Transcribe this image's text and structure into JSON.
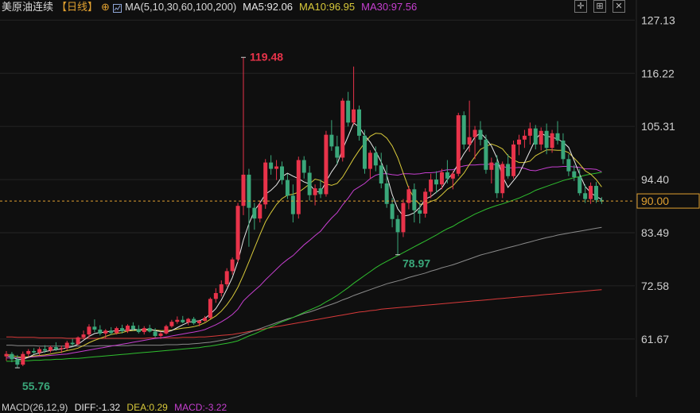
{
  "header": {
    "title": "美原油连续",
    "period": "【日线】",
    "add_icon": "plus-circle-icon",
    "indicator_icon": "chart-icon",
    "ma_def": "MA(5,10,30,60,100,200)",
    "ma5": "MA5:92.06",
    "ma10": "MA10:96.95",
    "ma30": "MA30:97.56"
  },
  "toolbar": {
    "icons": [
      "crosshair-icon",
      "layout-icon",
      "close-icon"
    ]
  },
  "macd": {
    "label": "MACD(26,12,9)",
    "diff": "DIFF:-1.32",
    "dea": "DEA:0.29",
    "macd": "MACD:-3.22"
  },
  "colors": {
    "up": "#e8334a",
    "down": "#3aa77a",
    "ma5": "#e8e8e8",
    "ma10": "#d8c93a",
    "ma30": "#c63fd0",
    "ma60": "#2fbf2f",
    "ma100": "#8a8a8a",
    "ma200": "#d83a3a",
    "current": "#e0a030"
  },
  "chart_data": {
    "type": "candlestick",
    "y_axis_ticks": [
      "127.13",
      "116.22",
      "105.31",
      "94.40",
      "83.49",
      "72.58",
      "61.67"
    ],
    "ylim": [
      53.0,
      128.0
    ],
    "current_price": "90.00",
    "annotations": {
      "high": "119.48",
      "low_mid": "78.97",
      "low_start": "55.76"
    },
    "ohlc": [
      [
        58.1,
        59.2,
        57.2,
        58.6
      ],
      [
        58.6,
        59.0,
        56.9,
        57.5
      ],
      [
        57.5,
        58.4,
        55.76,
        56.4
      ],
      [
        56.4,
        59.1,
        56.1,
        58.6
      ],
      [
        58.6,
        59.6,
        58.1,
        59.2
      ],
      [
        59.2,
        59.8,
        58.6,
        58.9
      ],
      [
        58.9,
        60.0,
        58.3,
        59.6
      ],
      [
        59.6,
        60.4,
        58.8,
        59.3
      ],
      [
        59.3,
        60.3,
        58.9,
        60.0
      ],
      [
        60.0,
        61.0,
        59.2,
        59.6
      ],
      [
        59.6,
        60.3,
        58.8,
        59.8
      ],
      [
        59.8,
        61.3,
        59.4,
        60.9
      ],
      [
        60.9,
        61.7,
        60.1,
        60.6
      ],
      [
        60.6,
        62.2,
        60.4,
        62.0
      ],
      [
        62.0,
        63.4,
        61.6,
        62.6
      ],
      [
        62.6,
        64.7,
        62.0,
        64.2
      ],
      [
        64.2,
        65.7,
        63.1,
        63.6
      ],
      [
        63.6,
        64.5,
        62.4,
        62.8
      ],
      [
        62.8,
        63.7,
        61.8,
        63.4
      ],
      [
        63.4,
        64.1,
        62.5,
        62.9
      ],
      [
        62.9,
        64.2,
        62.6,
        63.9
      ],
      [
        63.9,
        64.6,
        62.8,
        63.3
      ],
      [
        63.3,
        64.7,
        62.9,
        64.4
      ],
      [
        64.4,
        65.1,
        63.4,
        63.7
      ],
      [
        63.7,
        64.5,
        62.8,
        63.1
      ],
      [
        63.1,
        64.3,
        62.6,
        63.9
      ],
      [
        63.9,
        64.6,
        63.0,
        63.2
      ],
      [
        63.2,
        63.9,
        62.0,
        62.3
      ],
      [
        62.3,
        63.2,
        61.7,
        62.8
      ],
      [
        62.8,
        64.6,
        62.6,
        64.3
      ],
      [
        64.3,
        65.6,
        64.0,
        65.2
      ],
      [
        65.2,
        66.3,
        64.8,
        65.6
      ],
      [
        65.6,
        66.4,
        64.9,
        65.1
      ],
      [
        65.1,
        66.0,
        64.5,
        65.8
      ],
      [
        65.8,
        66.2,
        64.6,
        64.9
      ],
      [
        64.9,
        65.6,
        64.3,
        65.4
      ],
      [
        65.4,
        66.4,
        65.2,
        66.0
      ],
      [
        66.0,
        70.2,
        65.8,
        69.9
      ],
      [
        69.9,
        72.1,
        69.1,
        71.1
      ],
      [
        71.1,
        73.7,
        70.4,
        72.9
      ],
      [
        72.9,
        76.2,
        72.4,
        75.6
      ],
      [
        75.6,
        78.4,
        74.9,
        78.0
      ],
      [
        78.0,
        89.6,
        77.4,
        89.0
      ],
      [
        89.0,
        119.48,
        87.1,
        95.4
      ],
      [
        95.4,
        96.6,
        80.6,
        88.6
      ],
      [
        88.6,
        89.6,
        84.1,
        86.4
      ],
      [
        86.4,
        90.1,
        85.6,
        89.3
      ],
      [
        89.3,
        98.6,
        88.4,
        97.9
      ],
      [
        97.9,
        99.4,
        95.4,
        96.6
      ],
      [
        96.6,
        98.4,
        94.3,
        97.1
      ],
      [
        97.1,
        98.1,
        93.4,
        94.3
      ],
      [
        94.3,
        95.6,
        90.4,
        91.1
      ],
      [
        91.1,
        93.4,
        85.6,
        87.3
      ],
      [
        87.3,
        99.1,
        86.4,
        98.4
      ],
      [
        98.4,
        99.2,
        94.6,
        95.8
      ],
      [
        95.8,
        97.2,
        90.1,
        91.2
      ],
      [
        91.2,
        93.4,
        89.1,
        92.6
      ],
      [
        92.6,
        94.4,
        90.6,
        91.4
      ],
      [
        91.4,
        104.4,
        90.9,
        103.6
      ],
      [
        103.6,
        106.6,
        100.3,
        101.2
      ],
      [
        101.2,
        103.4,
        97.6,
        98.9
      ],
      [
        98.9,
        111.1,
        98.1,
        110.6
      ],
      [
        110.6,
        112.4,
        105.3,
        106.1
      ],
      [
        106.1,
        117.6,
        105.6,
        108.8
      ],
      [
        108.8,
        109.6,
        102.4,
        103.4
      ],
      [
        103.4,
        104.6,
        95.6,
        96.6
      ],
      [
        96.6,
        100.4,
        94.6,
        99.9
      ],
      [
        99.9,
        101.2,
        96.1,
        97.3
      ],
      [
        97.3,
        99.9,
        92.6,
        93.6
      ],
      [
        93.6,
        97.4,
        88.6,
        89.4
      ],
      [
        89.4,
        90.6,
        84.6,
        86.3
      ],
      [
        86.3,
        87.1,
        78.97,
        83.6
      ],
      [
        83.6,
        90.4,
        82.6,
        89.6
      ],
      [
        89.6,
        93.1,
        88.3,
        92.4
      ],
      [
        92.4,
        93.6,
        85.6,
        88.1
      ],
      [
        88.1,
        89.6,
        85.4,
        87.4
      ],
      [
        87.4,
        92.6,
        86.6,
        91.9
      ],
      [
        91.9,
        95.6,
        90.6,
        94.4
      ],
      [
        94.4,
        96.1,
        91.6,
        93.4
      ],
      [
        93.4,
        96.6,
        92.4,
        95.9
      ],
      [
        95.9,
        98.4,
        93.6,
        94.6
      ],
      [
        94.6,
        96.1,
        92.4,
        95.6
      ],
      [
        95.6,
        108.1,
        95.1,
        107.6
      ],
      [
        107.6,
        108.4,
        100.6,
        101.6
      ],
      [
        101.6,
        110.6,
        100.1,
        103.1
      ],
      [
        103.1,
        105.4,
        98.6,
        104.6
      ],
      [
        104.6,
        106.4,
        101.4,
        102.6
      ],
      [
        102.6,
        103.6,
        95.6,
        96.4
      ],
      [
        96.4,
        98.9,
        93.6,
        97.9
      ],
      [
        97.9,
        99.4,
        90.6,
        91.6
      ],
      [
        91.6,
        98.1,
        90.6,
        97.6
      ],
      [
        97.6,
        99.6,
        94.6,
        95.1
      ],
      [
        95.1,
        102.4,
        94.6,
        101.6
      ],
      [
        101.6,
        103.6,
        99.4,
        102.6
      ],
      [
        102.6,
        104.6,
        100.9,
        103.4
      ],
      [
        103.4,
        106.1,
        101.6,
        104.9
      ],
      [
        104.9,
        105.6,
        100.6,
        101.6
      ],
      [
        101.6,
        105.1,
        100.4,
        104.4
      ],
      [
        104.4,
        105.9,
        99.6,
        100.9
      ],
      [
        100.9,
        104.6,
        99.9,
        103.9
      ],
      [
        103.9,
        106.4,
        101.6,
        102.4
      ],
      [
        102.4,
        103.9,
        97.6,
        98.6
      ],
      [
        98.6,
        99.6,
        95.1,
        96.1
      ],
      [
        96.1,
        97.4,
        94.1,
        94.9
      ],
      [
        94.9,
        96.6,
        91.1,
        91.6
      ],
      [
        91.6,
        93.4,
        89.6,
        90.4
      ],
      [
        90.4,
        93.8,
        89.4,
        93.1
      ],
      [
        93.1,
        93.9,
        89.6,
        90.2
      ],
      [
        90.2,
        90.8,
        89.4,
        89.9
      ]
    ],
    "ma_series": [
      {
        "name": "MA5",
        "values": [
          58.2,
          58.0,
          57.5,
          57.5,
          57.9,
          58.5,
          58.8,
          59.1,
          59.3,
          59.5,
          59.6,
          59.9,
          60.1,
          60.6,
          61.4,
          62.2,
          62.8,
          63.0,
          63.1,
          63.3,
          63.3,
          63.4,
          63.5,
          63.6,
          63.6,
          63.6,
          63.7,
          63.4,
          63.2,
          63.1,
          63.4,
          64.0,
          64.6,
          65.1,
          65.3,
          65.4,
          65.9,
          66.8,
          67.9,
          69.7,
          71.9,
          74.3,
          77.6,
          82.0,
          85.3,
          88.0,
          89.6,
          91.4,
          92.2,
          93.3,
          95.0,
          95.7,
          95.1,
          94.6,
          93.9,
          93.5,
          92.0,
          91.8,
          94.0,
          96.0,
          97.6,
          100.6,
          103.3,
          106.0,
          105.2,
          103.5,
          102.1,
          100.2,
          98.0,
          95.3,
          91.3,
          88.4,
          86.9,
          87.1,
          87.6,
          88.7,
          90.4,
          90.9,
          91.8,
          92.7,
          94.4,
          95.7,
          97.7,
          99.7,
          101.3,
          103.1,
          104.0,
          102.8,
          101.3,
          98.8,
          95.1,
          92.8,
          94.2,
          95.6,
          97.9,
          100.3,
          102.7,
          103.9,
          103.3,
          103.1,
          102.7,
          102.1,
          101.0,
          98.3,
          95.5,
          93.0,
          91.7,
          90.9,
          90.3
        ]
      },
      {
        "name": "MA10",
        "values": [
          58.5,
          58.3,
          58.0,
          57.9,
          58.0,
          58.2,
          58.3,
          58.4,
          58.6,
          58.8,
          59.0,
          59.3,
          59.5,
          59.8,
          60.3,
          60.9,
          61.4,
          61.8,
          62.2,
          62.6,
          62.8,
          63.0,
          63.3,
          63.4,
          63.5,
          63.5,
          63.5,
          63.5,
          63.4,
          63.4,
          63.5,
          63.7,
          63.9,
          64.0,
          64.2,
          64.5,
          65.0,
          65.7,
          66.4,
          67.4,
          68.7,
          70.3,
          72.3,
          74.8,
          77.5,
          80.3,
          83.1,
          85.7,
          87.6,
          89.3,
          90.5,
          91.2,
          91.4,
          91.8,
          92.6,
          93.5,
          94.5,
          94.2,
          93.5,
          93.2,
          93.6,
          94.9,
          96.8,
          98.7,
          100.4,
          101.9,
          103.3,
          103.9,
          103.8,
          102.9,
          101.3,
          98.9,
          95.7,
          92.6,
          90.5,
          89.3,
          89.4,
          89.9,
          90.3,
          91.3,
          92.4,
          93.1,
          94.4,
          95.7,
          97.5,
          99.1,
          100.6,
          101.2,
          101.7,
          101.3,
          100.7,
          99.3,
          98.4,
          97.9,
          97.9,
          98.2,
          99.3,
          99.9,
          100.5,
          100.5,
          100.4,
          100.4,
          99.9,
          98.8,
          97.6,
          96.2,
          95.5,
          94.4,
          92.9
        ]
      },
      {
        "name": "MA30",
        "values": [
          57.8,
          57.8,
          57.8,
          57.8,
          57.9,
          58.0,
          58.1,
          58.2,
          58.3,
          58.4,
          58.5,
          58.6,
          58.8,
          59.0,
          59.2,
          59.4,
          59.6,
          59.8,
          60.0,
          60.2,
          60.4,
          60.6,
          60.8,
          61.0,
          61.2,
          61.4,
          61.6,
          61.8,
          61.9,
          62.1,
          62.3,
          62.5,
          62.7,
          62.9,
          63.1,
          63.3,
          63.6,
          64.1,
          64.6,
          65.2,
          65.9,
          66.7,
          67.8,
          69.5,
          70.6,
          71.6,
          72.6,
          73.8,
          74.9,
          76.0,
          77.1,
          78.0,
          78.8,
          79.9,
          81.0,
          81.9,
          82.9,
          83.8,
          85.2,
          86.5,
          87.6,
          89.2,
          90.6,
          92.2,
          92.9,
          93.6,
          94.6,
          95.3,
          95.6,
          95.6,
          95.4,
          95.3,
          95.6,
          95.6,
          95.5,
          95.6,
          95.8,
          95.8,
          95.9,
          96.2,
          96.4,
          96.4,
          96.9,
          97.2,
          97.4,
          97.4,
          97.5,
          97.5,
          97.6,
          97.4,
          97.1,
          96.8,
          96.8,
          96.9,
          96.7,
          96.3,
          96.2,
          96.5,
          96.8,
          97.0,
          97.0,
          97.1,
          97.1,
          97.0,
          96.9,
          96.6,
          96.6,
          96.5,
          96.0
        ]
      },
      {
        "name": "MA60",
        "values": [
          57.1,
          57.1,
          57.2,
          57.2,
          57.2,
          57.3,
          57.3,
          57.4,
          57.4,
          57.5,
          57.5,
          57.6,
          57.7,
          57.7,
          57.8,
          57.9,
          58.0,
          58.1,
          58.2,
          58.3,
          58.4,
          58.5,
          58.6,
          58.7,
          58.8,
          58.9,
          59.0,
          59.1,
          59.2,
          59.3,
          59.4,
          59.5,
          59.6,
          59.7,
          59.8,
          59.9,
          60.1,
          60.2,
          60.4,
          60.6,
          60.8,
          61.0,
          61.3,
          61.8,
          62.3,
          62.7,
          63.2,
          63.7,
          64.2,
          64.7,
          65.2,
          65.6,
          66.1,
          66.6,
          67.1,
          67.6,
          68.1,
          68.6,
          69.3,
          69.9,
          70.6,
          71.4,
          72.2,
          73.1,
          73.9,
          74.7,
          75.5,
          76.3,
          77.0,
          77.6,
          78.2,
          78.8,
          79.4,
          80.0,
          80.6,
          81.2,
          81.8,
          82.4,
          83.0,
          83.7,
          84.3,
          84.8,
          85.5,
          86.1,
          86.7,
          87.3,
          87.8,
          88.3,
          88.7,
          89.1,
          89.4,
          89.8,
          90.2,
          90.6,
          91.1,
          91.6,
          92.2,
          92.6,
          93.0,
          93.4,
          93.8,
          94.2,
          94.5,
          94.8,
          95.0,
          95.3,
          95.5,
          95.7,
          95.9
        ]
      },
      {
        "name": "MA100",
        "values": [
          60.4,
          60.4,
          60.3,
          60.3,
          60.3,
          60.3,
          60.2,
          60.2,
          60.2,
          60.2,
          60.2,
          60.2,
          60.2,
          60.2,
          60.2,
          60.2,
          60.2,
          60.3,
          60.3,
          60.3,
          60.3,
          60.3,
          60.3,
          60.4,
          60.4,
          60.4,
          60.4,
          60.4,
          60.4,
          60.5,
          60.5,
          60.5,
          60.6,
          60.6,
          60.7,
          60.8,
          60.9,
          61.0,
          61.2,
          61.4,
          61.6,
          61.9,
          62.2,
          62.6,
          63.0,
          63.4,
          63.8,
          64.2,
          64.6,
          65.0,
          65.4,
          65.8,
          66.1,
          66.5,
          66.9,
          67.2,
          67.6,
          68.0,
          68.4,
          68.8,
          69.2,
          69.7,
          70.1,
          70.6,
          71.0,
          71.4,
          71.8,
          72.2,
          72.6,
          73.0,
          73.3,
          73.6,
          73.9,
          74.3,
          74.6,
          74.9,
          75.2,
          75.6,
          75.9,
          76.3,
          76.6,
          76.9,
          77.3,
          77.7,
          78.1,
          78.5,
          78.9,
          79.2,
          79.5,
          79.8,
          80.1,
          80.4,
          80.7,
          81.0,
          81.3,
          81.6,
          81.9,
          82.2,
          82.5,
          82.7,
          83.0,
          83.2,
          83.4,
          83.6,
          83.8,
          84.0,
          84.2,
          84.4,
          84.6
        ]
      },
      {
        "name": "MA200",
        "values": [
          62.1,
          62.1,
          62.0,
          62.0,
          62.0,
          62.0,
          61.9,
          61.9,
          61.9,
          61.9,
          61.9,
          61.8,
          61.8,
          61.8,
          61.8,
          61.8,
          61.8,
          61.8,
          61.8,
          61.8,
          61.8,
          61.8,
          61.8,
          61.8,
          61.8,
          61.8,
          61.9,
          61.9,
          61.9,
          61.9,
          61.9,
          61.9,
          62.0,
          62.0,
          62.0,
          62.1,
          62.1,
          62.2,
          62.3,
          62.4,
          62.5,
          62.6,
          62.8,
          63.0,
          63.2,
          63.4,
          63.6,
          63.8,
          64.0,
          64.2,
          64.4,
          64.6,
          64.8,
          65.0,
          65.2,
          65.4,
          65.6,
          65.8,
          66.0,
          66.2,
          66.4,
          66.6,
          66.8,
          67.0,
          67.2,
          67.3,
          67.5,
          67.6,
          67.8,
          67.9,
          68.0,
          68.1,
          68.2,
          68.3,
          68.4,
          68.5,
          68.6,
          68.7,
          68.8,
          68.9,
          69.0,
          69.1,
          69.2,
          69.3,
          69.4,
          69.5,
          69.6,
          69.7,
          69.8,
          69.9,
          70.0,
          70.1,
          70.2,
          70.3,
          70.4,
          70.5,
          70.6,
          70.7,
          70.8,
          70.9,
          71.0,
          71.1,
          71.2,
          71.3,
          71.4,
          71.5,
          71.6,
          71.7,
          71.8
        ]
      }
    ]
  }
}
